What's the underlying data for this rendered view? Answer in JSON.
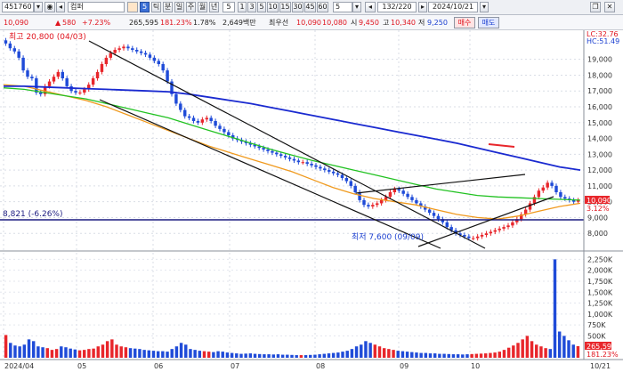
{
  "toolbar": {
    "code": "451760",
    "code_arrow": "▾",
    "tool1": "◉",
    "tool2": "◂",
    "stock_name": "컴퍼",
    "period_buttons": [
      "틱",
      "분",
      "일",
      "주",
      "월",
      "년"
    ],
    "period_selected": "5",
    "interval_count": "5",
    "interval_buttons": [
      "1",
      "3",
      "5",
      "10",
      "15",
      "30",
      "45",
      "60"
    ],
    "interval_value": "5",
    "counter": "132/220",
    "date": "2024/10/21"
  },
  "infobar": {
    "price": "10,090",
    "arrow": "▲",
    "change": "580",
    "change_pct": "+7.23%",
    "volume": "265,595",
    "volume_pct": "181.23%",
    "turnover_pct": "1.78%",
    "amount": "2,649백만",
    "label_best": "최우선",
    "best_price": "10,090",
    "best_price2": "10,080",
    "label_open": "시",
    "open": "9,450",
    "label_high": "고",
    "high": "10,340",
    "label_low": "저",
    "low": "9,250",
    "buy_label": "매수",
    "sell_label": "매도"
  },
  "chart": {
    "max_label": "최고 20,800 (04/03)",
    "min_label": "최저 7,600 (09/09)",
    "level_label": "8,821 (-6.26%)",
    "lc_label": "LC:32.76",
    "hc_label": "HC:51.49",
    "current_price_tag": "10,090",
    "current_pct_tag": "3.12%",
    "volume_tag": "265,595",
    "volume_pct_tag": "181.23%",
    "y_ticks": [
      "19,000",
      "18,000",
      "17,000",
      "16,000",
      "15,000",
      "14,000",
      "13,000",
      "12,000",
      "11,000",
      "10,000",
      "9,000",
      "8,000"
    ],
    "volume_ticks": [
      "2,250K",
      "2,000K",
      "1,750K",
      "1,500K",
      "1,250K",
      "1,000K",
      "750K",
      "500K"
    ],
    "x_labels": [
      "2024/04",
      "05",
      "06",
      "07",
      "08",
      "09",
      "10",
      "10/21"
    ],
    "colors": {
      "up": "#e8262b",
      "down": "#1f4bd8",
      "ma5": "#d62f8a",
      "ma20": "#f09a1e",
      "ma60": "#22c222",
      "ma120": "#1a2ad0",
      "highlight": "#d8e020",
      "level": "#1c1c80",
      "trend": "#111111"
    }
  },
  "chart_data": {
    "type": "candlestick",
    "x": [
      "2024/04",
      "05",
      "06",
      "07",
      "08",
      "09",
      "10",
      "10/21"
    ],
    "close_series": [
      20000,
      19700,
      19500,
      19100,
      18300,
      17900,
      17800,
      16900,
      16800,
      17300,
      17600,
      17900,
      18200,
      17800,
      17300,
      17000,
      16900,
      16900,
      17100,
      17400,
      17800,
      18200,
      18700,
      19100,
      19400,
      19600,
      19700,
      19800,
      19700,
      19600,
      19500,
      19400,
      19300,
      19100,
      18900,
      18700,
      18300,
      17600,
      16800,
      16200,
      15800,
      15400,
      15300,
      15100,
      15000,
      15200,
      15300,
      15100,
      14800,
      14600,
      14400,
      14200,
      14000,
      13900,
      13800,
      13700,
      13600,
      13500,
      13400,
      13300,
      13200,
      13100,
      13000,
      12900,
      12800,
      12700,
      12600,
      12500,
      12500,
      12400,
      12300,
      12200,
      12100,
      12000,
      11900,
      11800,
      11700,
      11500,
      11300,
      11000,
      10600,
      10100,
      9800,
      9700,
      9800,
      9900,
      10100,
      10300,
      10600,
      10800,
      10700,
      10500,
      10300,
      10100,
      9900,
      9700,
      9500,
      9300,
      9100,
      8900,
      8700,
      8400,
      8200,
      8000,
      7900,
      7800,
      7700,
      7700,
      7800,
      7900,
      8000,
      8100,
      8200,
      8300,
      8400,
      8500,
      8700,
      8900,
      9200,
      9500,
      9900,
      10300,
      10700,
      10900,
      11200,
      11000,
      10600,
      10300,
      10200,
      10100,
      10000,
      10090
    ],
    "volume_series": [
      520,
      340,
      280,
      260,
      300,
      420,
      380,
      260,
      240,
      220,
      180,
      200,
      260,
      240,
      210,
      190,
      170,
      180,
      200,
      210,
      260,
      300,
      380,
      420,
      300,
      260,
      240,
      220,
      210,
      200,
      180,
      170,
      160,
      150,
      150,
      140,
      200,
      260,
      340,
      300,
      200,
      180,
      160,
      150,
      140,
      130,
      150,
      140,
      120,
      110,
      100,
      90,
      95,
      100,
      90,
      85,
      80,
      80,
      75,
      80,
      70,
      70,
      65,
      60,
      60,
      60,
      65,
      70,
      80,
      90,
      100,
      110,
      120,
      140,
      160,
      200,
      260,
      300,
      380,
      340,
      300,
      260,
      220,
      200,
      180,
      160,
      150,
      140,
      130,
      120,
      110,
      110,
      100,
      100,
      90,
      90,
      85,
      80,
      80,
      75,
      80,
      85,
      90,
      95,
      100,
      110,
      120,
      140,
      180,
      230,
      280,
      340,
      420,
      500,
      380,
      300,
      260,
      220,
      200,
      2250,
      600,
      500,
      400,
      300,
      265
    ],
    "ma120": [
      17300,
      17300,
      17250,
      17200,
      17150,
      17100,
      17050,
      17000,
      16950,
      16800,
      16600,
      16400,
      16200,
      15950,
      15700,
      15450,
      15200,
      14950,
      14700,
      14450,
      14200,
      13950,
      13700,
      13400,
      13100,
      12800,
      12500,
      12200,
      12000
    ],
    "ma60": [
      17200,
      17100,
      16900,
      16700,
      16500,
      16200,
      15900,
      15600,
      15300,
      14900,
      14500,
      14100,
      13700,
      13300,
      12950,
      12600,
      12300,
      12000,
      11700,
      11400,
      11100,
      10800,
      10600,
      10400,
      10300,
      10250,
      10200,
      10150,
      10100
    ],
    "ma20": [
      17400,
      17300,
      17000,
      16700,
      16400,
      16000,
      15500,
      15000,
      14500,
      14000,
      13500,
      13100,
      12700,
      12300,
      11900,
      11400,
      10900,
      10500,
      10200,
      10000,
      9800,
      9500,
      9200,
      9000,
      8900,
      9100,
      9400,
      9700,
      9900
    ],
    "ylim": [
      7000,
      20500
    ]
  }
}
